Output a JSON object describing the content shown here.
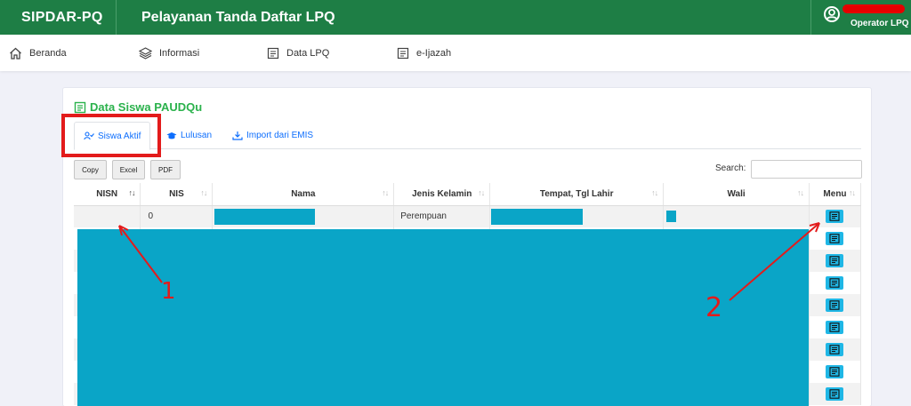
{
  "header": {
    "brand": "SIPDAR-PQ",
    "title": "Pelayanan Tanda Daftar LPQ",
    "user_role": "Operator LPQ"
  },
  "nav": {
    "items": [
      {
        "label": "Beranda",
        "icon": "home-icon"
      },
      {
        "label": "Informasi",
        "icon": "layers-icon"
      },
      {
        "label": "Data LPQ",
        "icon": "document-icon"
      },
      {
        "label": "e-Ijazah",
        "icon": "document-icon"
      }
    ]
  },
  "card": {
    "title": "Data Siswa PAUDQu",
    "tabs": [
      {
        "label": "Siswa Aktif",
        "icon": "user-check-icon",
        "active": true
      },
      {
        "label": "Lulusan",
        "icon": "graduation-cap-icon",
        "active": false
      },
      {
        "label": "Import dari EMIS",
        "icon": "download-icon",
        "active": false
      }
    ],
    "buttons": {
      "copy": "Copy",
      "excel": "Excel",
      "pdf": "PDF"
    },
    "search_label": "Search:",
    "search_value": ""
  },
  "table": {
    "columns": [
      "NISN",
      "NIS",
      "Nama",
      "Jenis Kelamin",
      "Tempat, Tgl Lahir",
      "Wali",
      "Menu"
    ],
    "first_row": {
      "nisn": "",
      "nis": "0",
      "jenis_kelamin": "Perempuan"
    }
  },
  "annotations": {
    "label_1": "1",
    "label_2": "2",
    "color": "#e31b1b"
  },
  "colors": {
    "header_green": "#1e7e45",
    "title_green": "#2bb24c",
    "link_blue": "#0d6efd",
    "menu_button": "#1fb7e6",
    "redaction": "#0aa5c7"
  }
}
